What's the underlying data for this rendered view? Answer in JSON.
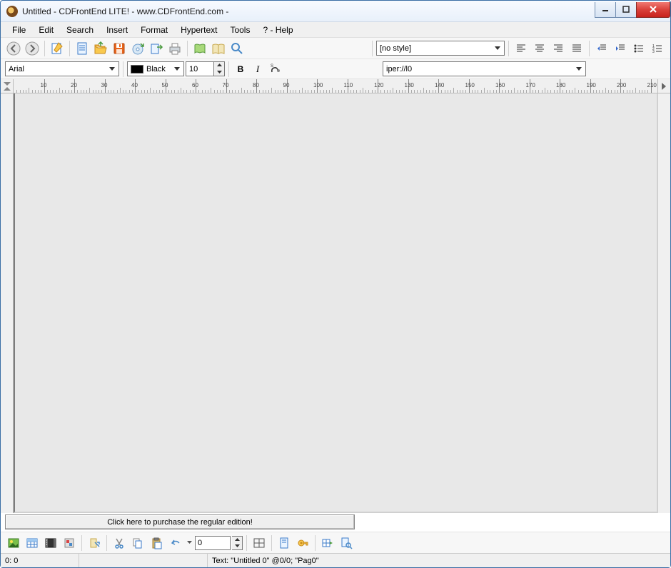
{
  "window": {
    "title": "Untitled - CDFrontEnd LITE! - www.CDFrontEnd.com -"
  },
  "menu": {
    "items": [
      "File",
      "Edit",
      "Search",
      "Insert",
      "Format",
      "Hypertext",
      "Tools",
      "? - Help"
    ]
  },
  "toolbar1": {
    "style_combo": "[no style]"
  },
  "toolbar2": {
    "font": "Arial",
    "color_name": "Black",
    "font_size": "10",
    "url": "iper://l0"
  },
  "ruler": {
    "labels": [
      "10",
      "20",
      "30",
      "40",
      "50",
      "60",
      "70",
      "80",
      "90",
      "100",
      "110",
      "120",
      "130",
      "140",
      "150",
      "160",
      "170",
      "180",
      "190",
      "200",
      "210"
    ]
  },
  "bottom_toolbar": {
    "counter": "0"
  },
  "purchase": {
    "label": "Click here to purchase the regular edition!"
  },
  "status": {
    "coords": "0: 0",
    "text": "Text: \"Untitled 0\" @0/0; \"Pag0\""
  }
}
